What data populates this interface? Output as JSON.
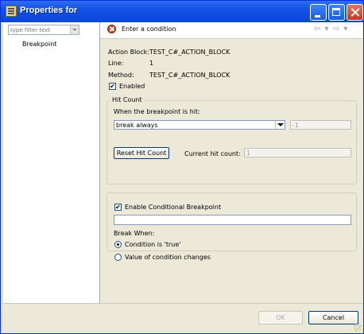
{
  "window": {
    "title": "Properties for"
  },
  "sidebar": {
    "filter_placeholder": "type filter text",
    "items": [
      {
        "label": "Breakpoint"
      }
    ]
  },
  "header": {
    "message": "Enter a condition",
    "nav_symbols": "⇦ ▾ ⇨ ▾"
  },
  "details": {
    "action_block_label": "Action Block:",
    "action_block_value": "TEST_C#_ACTION_BLOCK",
    "line_label": "Line:",
    "line_value": "1",
    "method_label": "Method:",
    "method_value": "TEST_C#_ACTION_BLOCK",
    "enabled_label": "Enabled",
    "enabled_checked": true
  },
  "hit_count": {
    "group_title": "Hit Count",
    "when_label": "When the breakpoint is hit:",
    "selected_option": "break always",
    "count_value": "-1",
    "reset_button": "Reset Hit Count",
    "current_label": "Current hit count:",
    "current_value": "1"
  },
  "conditional": {
    "enable_label": "Enable Conditional Breakpoint",
    "enable_checked": true,
    "condition_value": "",
    "break_when_label": "Break When:",
    "options": [
      {
        "label": "Condition is 'true'",
        "selected": true
      },
      {
        "label": "Value of condition changes",
        "selected": false
      }
    ]
  },
  "footer": {
    "ok_label": "OK",
    "cancel_label": "Cancel"
  },
  "colors": {
    "titlebar": "#0a45d8",
    "dialog_bg": "#ece9d8",
    "error_icon": "#d84428"
  },
  "icons": {
    "app": "properties-icon",
    "error": "error-icon",
    "minimize": "minimize-icon",
    "maximize": "maximize-icon",
    "close": "close-icon"
  }
}
